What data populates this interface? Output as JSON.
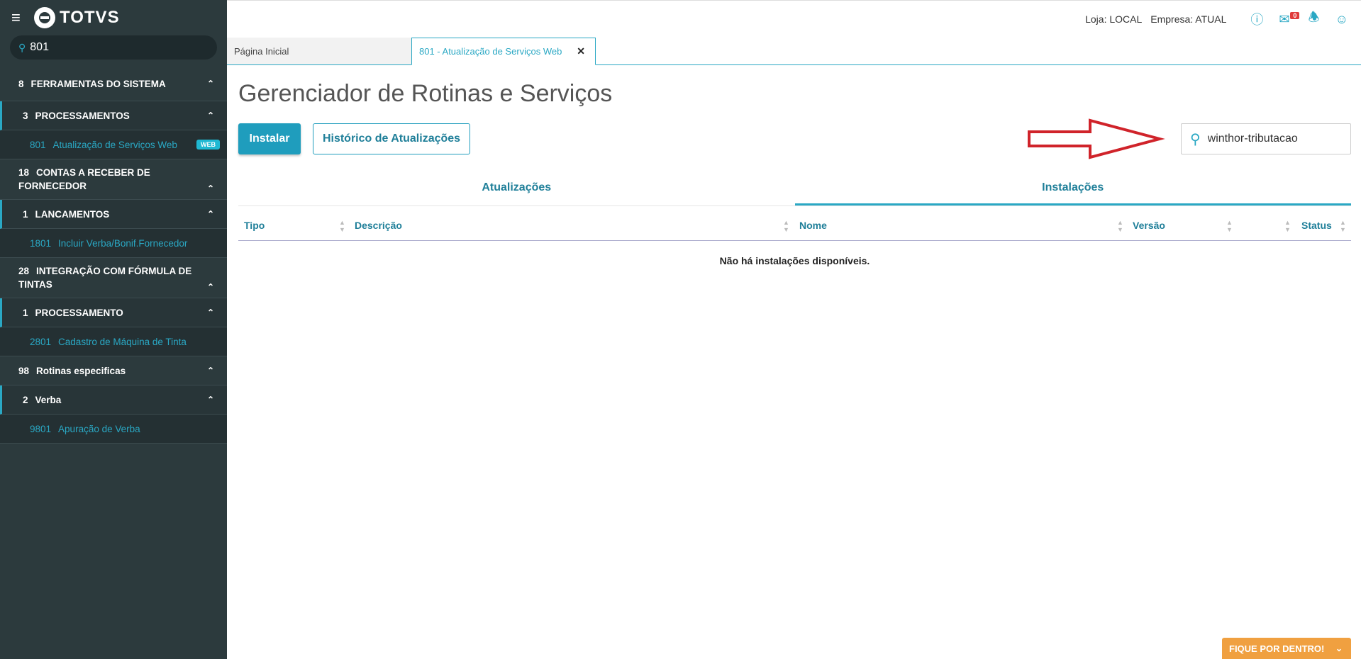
{
  "sidebar": {
    "logo_text": "TOTVS",
    "search_value": "801",
    "items": [
      {
        "code": "8",
        "label": "FERRAMENTAS DO SISTEMA"
      },
      {
        "code": "3",
        "label": "PROCESSAMENTOS"
      },
      {
        "code": "801",
        "label": "Atualização de Serviços Web",
        "badge": "WEB"
      },
      {
        "code": "18",
        "label": "CONTAS A RECEBER DE FORNECEDOR"
      },
      {
        "code": "1",
        "label": "LANCAMENTOS"
      },
      {
        "code": "1801",
        "label": "Incluir Verba/Bonif.Fornecedor"
      },
      {
        "code": "28",
        "label": "INTEGRAÇÃO COM FÓRMULA DE TINTAS"
      },
      {
        "code": "1",
        "label": "PROCESSAMENTO"
      },
      {
        "code": "2801",
        "label": "Cadastro de Máquina de Tinta"
      },
      {
        "code": "98",
        "label": "Rotinas especificas"
      },
      {
        "code": "2",
        "label": "Verba"
      },
      {
        "code": "9801",
        "label": "Apuração de Verba"
      }
    ]
  },
  "topbar": {
    "loja": "Loja: LOCAL",
    "empresa": "Empresa: ATUAL",
    "mail_count": "0"
  },
  "tabs": {
    "home": "Página Inicial",
    "active": "801 - Atualização de Serviços Web"
  },
  "main": {
    "title": "Gerenciador de Rotinas e Serviços",
    "install_label": "Instalar",
    "history_label": "Histórico de Atualizações",
    "search_value": "winthor-tributacao",
    "subtabs": [
      "Atualizações",
      "Instalações"
    ],
    "columns": [
      "Tipo",
      "Descrição",
      "Nome",
      "Versão",
      "Status"
    ],
    "empty_message": "Não há instalações disponíveis."
  },
  "footer": {
    "fique_label": "FIQUE POR DENTRO!"
  },
  "colors": {
    "sidebar_bg": "#2c3a3d",
    "accent": "#2aa8c4",
    "primary_button": "#1f9dbd",
    "footer_button": "#f0a040",
    "annotation_arrow": "#d0232a"
  }
}
